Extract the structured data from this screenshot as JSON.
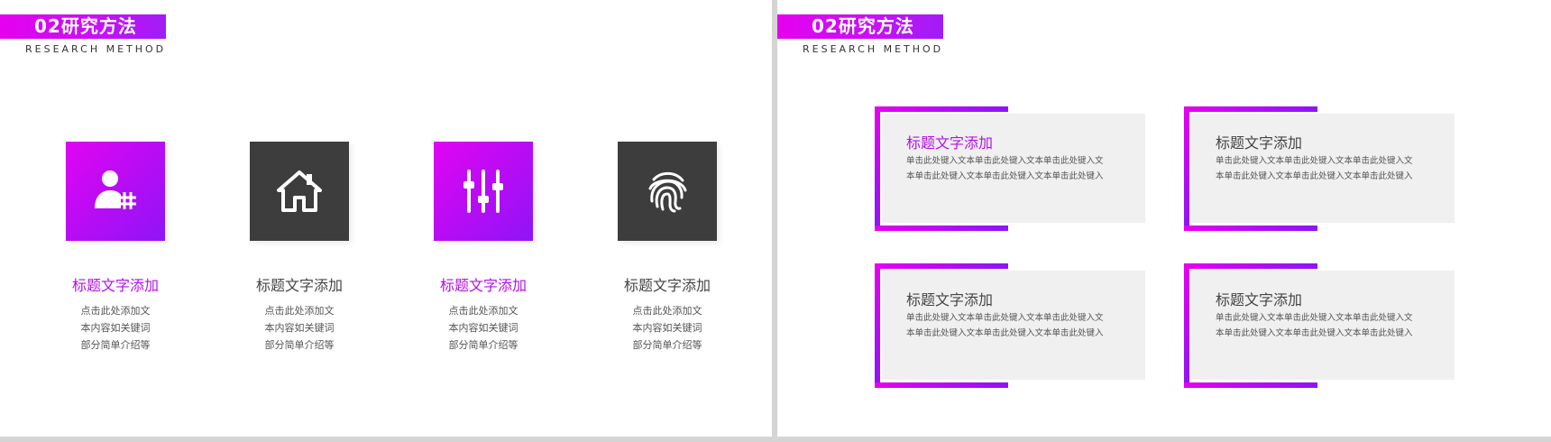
{
  "left": {
    "title": "02研究方法",
    "subtitle": "RESEARCH METHOD",
    "features": [
      {
        "icon": "user-hash-icon",
        "title": "标题文字添加",
        "lines": [
          "点击此处添加文",
          "本内容如关键词",
          "部分简单介绍等"
        ],
        "accent": "#b410e6"
      },
      {
        "icon": "home-icon",
        "title": "标题文字添加",
        "lines": [
          "点击此处添加文",
          "本内容如关键词",
          "部分简单介绍等"
        ],
        "accent": "#444444"
      },
      {
        "icon": "sliders-icon",
        "title": "标题文字添加",
        "lines": [
          "点击此处添加文",
          "本内容如关键词",
          "部分简单介绍等"
        ],
        "accent": "#b410e6"
      },
      {
        "icon": "fingerprint-icon",
        "title": "标题文字添加",
        "lines": [
          "点击此处添加文",
          "本内容如关键词",
          "部分简单介绍等"
        ],
        "accent": "#444444"
      }
    ]
  },
  "right": {
    "title": "02研究方法",
    "subtitle": "RESEARCH METHOD",
    "cards": [
      {
        "title": "标题文字添加",
        "body": "单击此处键入文本单击此处键入文本单击此处键入文本单击此处键入文本单击此处键入文本单击此处键入"
      },
      {
        "title": "标题文字添加",
        "body": "单击此处键入文本单击此处键入文本单击此处键入文本单击此处键入文本单击此处键入文本单击此处键入"
      },
      {
        "title": "标题文字添加",
        "body": "单击此处键入文本单击此处键入文本单击此处键入文本单击此处键入文本单击此处键入文本单击此处键入"
      },
      {
        "title": "标题文字添加",
        "body": "单击此处键入文本单击此处键入文本单击此处键入文本单击此处键入文本单击此处键入文本单击此处键入"
      }
    ]
  },
  "colors": {
    "accent_start": "#e600f0",
    "accent_end": "#8e14f6",
    "dark_square": "#3d3d3d",
    "card_bg": "#f0f0f0"
  }
}
